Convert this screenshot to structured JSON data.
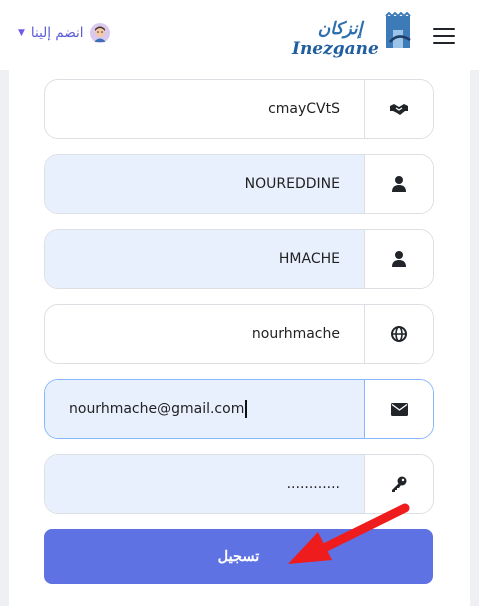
{
  "header": {
    "join_label": "انضم إلينا",
    "logo_arabic": "إنزكان",
    "logo_latin": "Inezgane",
    "menu_icon": "hamburger-icon",
    "avatar_icon": "user-avatar-icon"
  },
  "form": {
    "fields": [
      {
        "name": "username",
        "value": "cmayCVtS",
        "icon": "handshake-icon"
      },
      {
        "name": "first-name",
        "value": "NOUREDDINE",
        "icon": "user-icon"
      },
      {
        "name": "last-name",
        "value": "HMACHE",
        "icon": "user-icon"
      },
      {
        "name": "website",
        "value": "nourhmache",
        "icon": "globe-icon"
      },
      {
        "name": "email",
        "value": "nourhmache@gmail.com",
        "icon": "envelope-icon"
      },
      {
        "name": "password",
        "value": "............",
        "icon": "key-icon"
      }
    ],
    "submit_label": "تسجيل"
  },
  "colors": {
    "accent": "#5f72e3",
    "autofill": "#e8f0fe",
    "focus_border": "#86b7fe",
    "annotation_arrow": "#ee1c1c"
  }
}
